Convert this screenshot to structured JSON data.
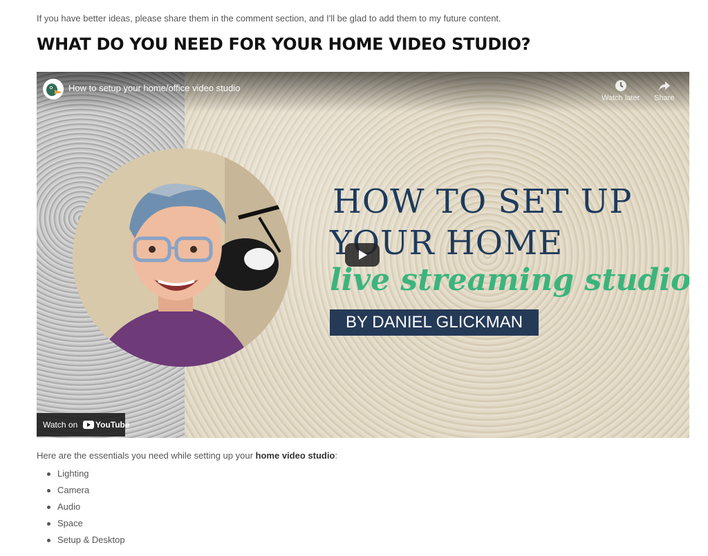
{
  "intro_text": "If you have better ideas, please share them in the comment section, and I'll be glad to add them to my future content.",
  "heading": "WHAT DO YOU NEED FOR YOUR HOME VIDEO STUDIO?",
  "video": {
    "title": "How to setup your home/office video studio",
    "watch_later_label": "Watch later",
    "share_label": "Share",
    "thumbnail_line1": "HOW TO SET UP",
    "thumbnail_line2": "YOUR HOME",
    "thumbnail_script": "live streaming studio",
    "thumbnail_byline": "BY DANIEL GLICKMAN",
    "watch_on_label": "Watch on",
    "youtube_logo_text": "YouTube",
    "icons": {
      "channel": "channel-avatar-icon",
      "watch_later": "clock-icon",
      "share": "share-arrow-icon",
      "play": "play-icon",
      "youtube": "youtube-logo-icon"
    },
    "colors": {
      "navy_text": "#1e3a5c",
      "script_green": "#3cb47c",
      "byline_bg": "#253a57"
    }
  },
  "essentials": {
    "prefix": "Here are the essentials you need while setting up your ",
    "bold": "home video studio",
    "suffix": ":"
  },
  "list_items": [
    "Lighting",
    "Camera",
    "Audio",
    "Space",
    "Setup & Desktop"
  ]
}
